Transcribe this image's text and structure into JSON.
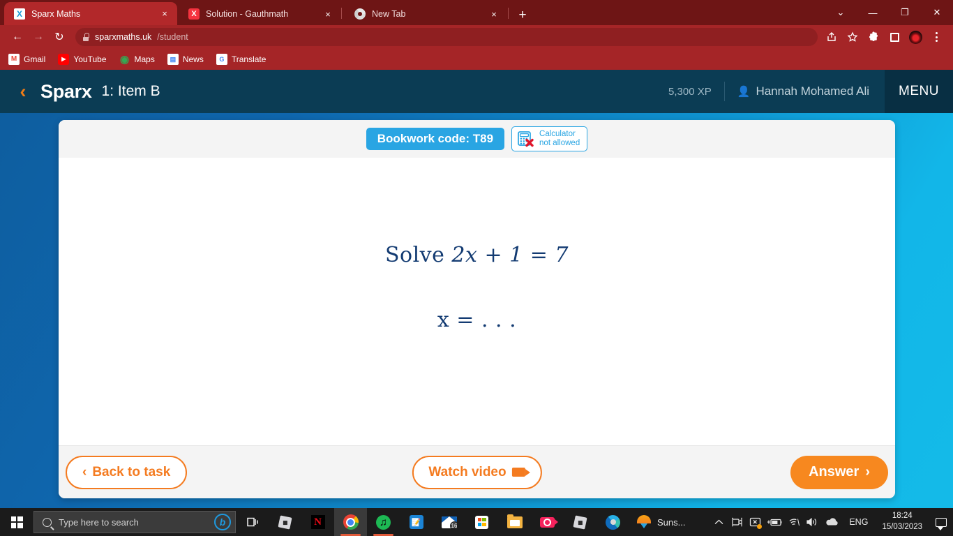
{
  "browser": {
    "tabs": [
      {
        "title": "Sparx Maths",
        "favicon": "sparx-x-icon",
        "active": true,
        "close_label": "×"
      },
      {
        "title": "Solution - Gauthmath",
        "favicon": "gauthmath-icon",
        "active": false,
        "close_label": "×"
      },
      {
        "title": "New Tab",
        "favicon": "chrome-icon",
        "active": false,
        "close_label": "×"
      }
    ],
    "new_tab_label": "+",
    "window_controls": {
      "minimize": "—",
      "restore": "❐",
      "close": "✕",
      "collapse": "⌄"
    },
    "nav": {
      "back": "←",
      "forward": "→",
      "reload": "↻"
    },
    "url": {
      "host": "sparxmaths.uk",
      "path": "/student",
      "lock": "lock-icon"
    },
    "toolbar_icons": [
      "share-icon",
      "bookmark-star-icon",
      "extensions-puzzle-icon",
      "sidepanel-icon",
      "profile-avatar-icon",
      "chrome-menu-icon"
    ],
    "bookmarks": [
      {
        "label": "Gmail",
        "icon": "gmail-icon",
        "glyph": "M"
      },
      {
        "label": "YouTube",
        "icon": "youtube-icon",
        "glyph": "▶"
      },
      {
        "label": "Maps",
        "icon": "maps-icon",
        "glyph": "◉"
      },
      {
        "label": "News",
        "icon": "news-icon",
        "glyph": "▤"
      },
      {
        "label": "Translate",
        "icon": "translate-icon",
        "glyph": "G"
      }
    ]
  },
  "sparx": {
    "back_chevron": "‹",
    "brand": "Sparx",
    "item_label": "1: Item B",
    "xp": "5,300 XP",
    "user_name": "Hannah Mohamed Ali",
    "user_icon": "person-icon",
    "menu_label": "MENU"
  },
  "card": {
    "bookwork_code": "Bookwork code: T89",
    "calculator": {
      "line1": "Calculator",
      "line2": "not allowed",
      "icon": "calculator-not-allowed-icon"
    },
    "question": {
      "prompt_prefix": "Solve ",
      "equation": "2x + 1 = 7",
      "answer_line": "x = . . ."
    },
    "buttons": {
      "back_to_task": "Back to task",
      "back_chevron": "‹",
      "watch_video": "Watch video",
      "video_icon": "video-camera-icon",
      "answer": "Answer",
      "answer_chevron": "›"
    }
  },
  "taskbar": {
    "start_icon": "windows-start-icon",
    "search_placeholder": "Type here to search",
    "search_icon": "search-icon",
    "bing_icon": "bing-chat-icon",
    "items": [
      {
        "name": "task-view-icon",
        "label": ""
      },
      {
        "name": "roblox-icon",
        "label": ""
      },
      {
        "name": "netflix-icon",
        "label": "N"
      },
      {
        "name": "chrome-icon",
        "label": ""
      },
      {
        "name": "spotify-icon",
        "label": ""
      },
      {
        "name": "teams-icon",
        "label": ""
      },
      {
        "name": "mail-icon",
        "label": "16"
      },
      {
        "name": "microsoft-store-icon",
        "label": ""
      },
      {
        "name": "file-explorer-icon",
        "label": ""
      },
      {
        "name": "screen-recorder-icon",
        "label": ""
      },
      {
        "name": "roblox-studio-icon",
        "label": ""
      },
      {
        "name": "edge-icon",
        "label": ""
      }
    ],
    "sunset_label": "Suns...",
    "sunset_icon": "sunset-icon",
    "tray": [
      {
        "name": "show-hidden-icons-chevron",
        "glyph": "∧"
      },
      {
        "name": "camera-icon",
        "glyph": "▭"
      },
      {
        "name": "display-settings-icon",
        "glyph": "⧉"
      },
      {
        "name": "battery-charging-icon",
        "glyph": "▃"
      },
      {
        "name": "wifi-icon",
        "glyph": "◠"
      },
      {
        "name": "volume-icon",
        "glyph": "◂"
      },
      {
        "name": "onedrive-icon",
        "glyph": "☁"
      }
    ],
    "language": "ENG",
    "time": "18:24",
    "date": "15/03/2023",
    "notifications_icon": "notifications-icon"
  },
  "colors": {
    "chrome_frame": "#a52527",
    "chrome_tabstrip": "#6e1515",
    "sparx_header": "#0b3c54",
    "accent_orange": "#f7881f",
    "bookwork_blue": "#29a5e3",
    "math_navy": "#133b72"
  }
}
